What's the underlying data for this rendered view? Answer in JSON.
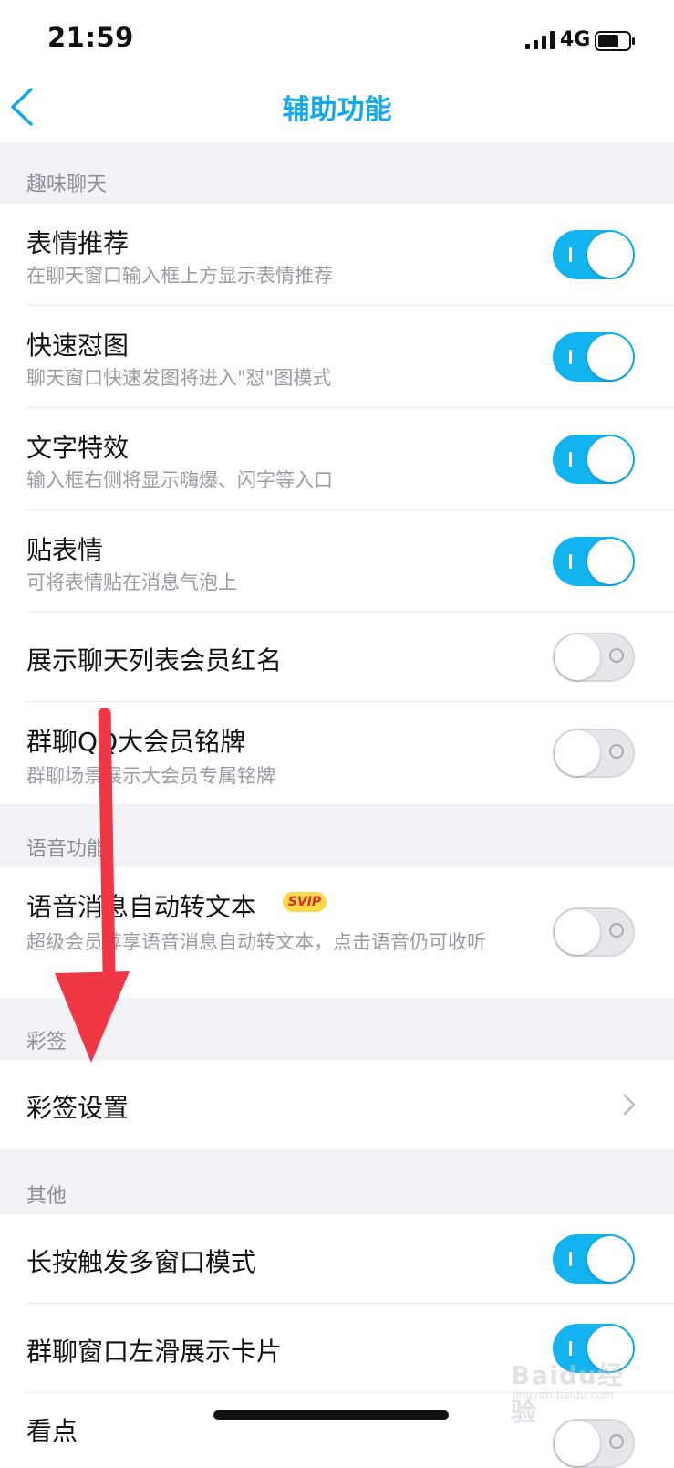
{
  "status_bar": {
    "time": "21:59",
    "network": "4G"
  },
  "nav": {
    "title": "辅助功能"
  },
  "sections": {
    "fun_chat": {
      "label": "趣味聊天",
      "rows": [
        {
          "title": "表情推荐",
          "subtitle": "在聊天窗口输入框上方显示表情推荐",
          "enabled": true
        },
        {
          "title": "快速怼图",
          "subtitle": "聊天窗口快速发图将进入\"怼\"图模式",
          "enabled": true
        },
        {
          "title": "文字特效",
          "subtitle": "输入框右侧将显示嗨爆、闪字等入口",
          "enabled": true
        },
        {
          "title": "贴表情",
          "subtitle": "可将表情贴在消息气泡上",
          "enabled": true
        },
        {
          "title": "展示聊天列表会员红名",
          "enabled": false
        },
        {
          "title": "群聊QQ大会员铭牌",
          "subtitle": "群聊场景展示大会员专属铭牌",
          "enabled": false
        }
      ]
    },
    "voice": {
      "label": "语音功能",
      "rows": [
        {
          "title": "语音消息自动转文本",
          "badge": "SVIP",
          "subtitle": "超级会员尊享语音消息自动转文本，点击语音仍可收听",
          "enabled": false
        }
      ]
    },
    "caiqian": {
      "label": "彩签",
      "rows": [
        {
          "title": "彩签设置"
        }
      ]
    },
    "other": {
      "label": "其他",
      "rows": [
        {
          "title": "长按触发多窗口模式",
          "enabled": true
        },
        {
          "title": "群聊窗口左滑展示卡片",
          "enabled": true
        },
        {
          "title": "看点",
          "enabled": false
        }
      ]
    }
  },
  "watermark": {
    "text": "Baidu经验",
    "subtext": "jingyan.baidu.com"
  },
  "colors": {
    "accent": "#13a8ea",
    "toggle_on": "#12b3ee",
    "section_bg": "#f1f2f6",
    "annotation_arrow": "#f03745"
  }
}
